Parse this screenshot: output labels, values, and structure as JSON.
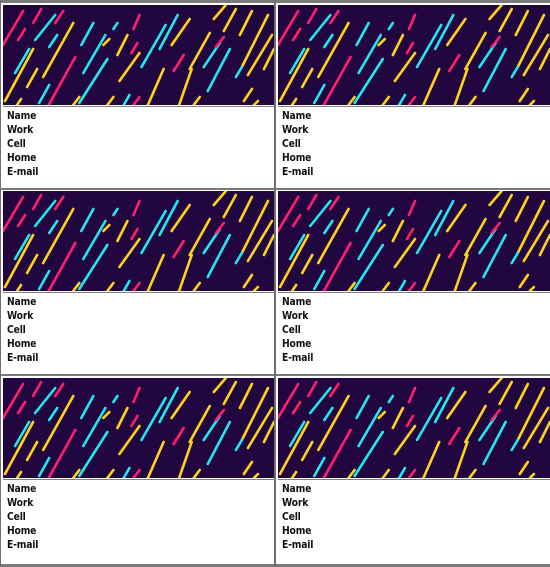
{
  "document": {
    "type": "contact-card-sheet",
    "rows": 3,
    "columns": 2
  },
  "banner_colors": {
    "background": "#22063f",
    "pink": "#ff1f6d",
    "cyan": "#22e6f0",
    "yellow": "#ffd319"
  },
  "cards": [
    {
      "fields": [
        "Name",
        "Work",
        "Cell",
        "Home",
        "E-mail"
      ]
    },
    {
      "fields": [
        "Name",
        "Work",
        "Cell",
        "Home",
        "E-mail"
      ]
    },
    {
      "fields": [
        "Name",
        "Work",
        "Cell",
        "Home",
        "E-mail"
      ]
    },
    {
      "fields": [
        "Name",
        "Work",
        "Cell",
        "Home",
        "E-mail"
      ]
    },
    {
      "fields": [
        "Name",
        "Work",
        "Cell",
        "Home",
        "E-mail"
      ]
    },
    {
      "fields": [
        "Name",
        "Work",
        "Cell",
        "Home",
        "E-mail"
      ]
    }
  ]
}
